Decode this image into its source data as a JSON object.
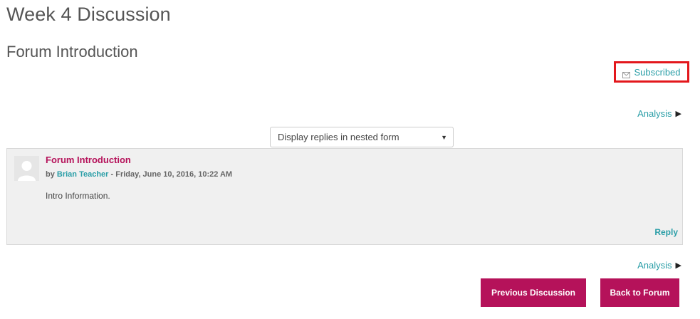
{
  "page": {
    "title": "Week 4 Discussion",
    "forum_title": "Forum Introduction"
  },
  "subscription": {
    "label": "Subscribed",
    "icon": "envelope-icon",
    "highlight_color": "#e3171c"
  },
  "analysis": {
    "top_label": "Analysis",
    "bottom_label": "Analysis",
    "arrow": "▶"
  },
  "display_mode": {
    "selected": "Display replies in nested form",
    "caret": "▼"
  },
  "post": {
    "subject": "Forum Introduction",
    "by_prefix": "by",
    "author": "Brian Teacher",
    "date_text": " - Friday, June 10, 2016, 10:22 AM",
    "body": "Intro Information.",
    "reply_label": "Reply"
  },
  "nav": {
    "previous_label": "Previous Discussion",
    "back_label": "Back to Forum"
  },
  "colors": {
    "accent_link": "#2a9ea7",
    "brand_button": "#b5125a",
    "post_background": "#f0f0f0"
  }
}
